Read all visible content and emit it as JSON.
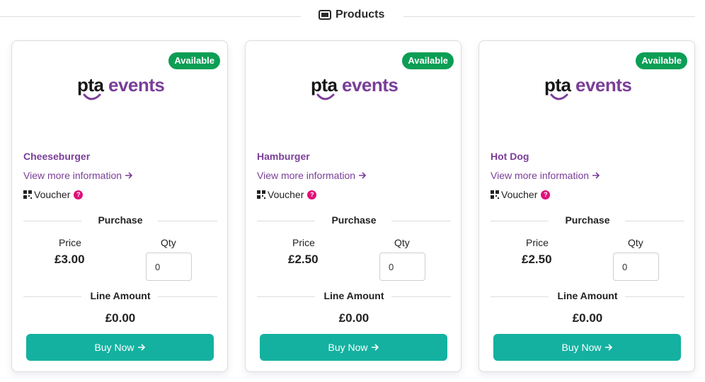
{
  "section": {
    "title": "Products",
    "icon": "ticket-icon"
  },
  "products": [
    {
      "badge": "Available",
      "logo_text_a": "pta",
      "logo_text_b": "events",
      "name": "Cheeseburger",
      "more_info": "View more information",
      "voucher": "Voucher",
      "purchase_heading": "Purchase",
      "price_label": "Price",
      "price": "£3.00",
      "qty_label": "Qty",
      "qty_value": "0",
      "line_amount_heading": "Line Amount",
      "line_amount": "£0.00",
      "buy_label": "Buy Now"
    },
    {
      "badge": "Available",
      "logo_text_a": "pta",
      "logo_text_b": "events",
      "name": "Hamburger",
      "more_info": "View more information",
      "voucher": "Voucher",
      "purchase_heading": "Purchase",
      "price_label": "Price",
      "price": "£2.50",
      "qty_label": "Qty",
      "qty_value": "0",
      "line_amount_heading": "Line Amount",
      "line_amount": "£0.00",
      "buy_label": "Buy Now"
    },
    {
      "badge": "Available",
      "logo_text_a": "pta",
      "logo_text_b": "events",
      "name": "Hot Dog",
      "more_info": "View more information",
      "voucher": "Voucher",
      "purchase_heading": "Purchase",
      "price_label": "Price",
      "price": "£2.50",
      "qty_label": "Qty",
      "qty_value": "0",
      "line_amount_heading": "Line Amount",
      "line_amount": "£0.00",
      "buy_label": "Buy Now"
    }
  ],
  "colors": {
    "brand_purple": "#7a3e98",
    "available_green": "#0c9e55",
    "button_teal": "#14b1a0",
    "help_pink": "#e0107a"
  }
}
